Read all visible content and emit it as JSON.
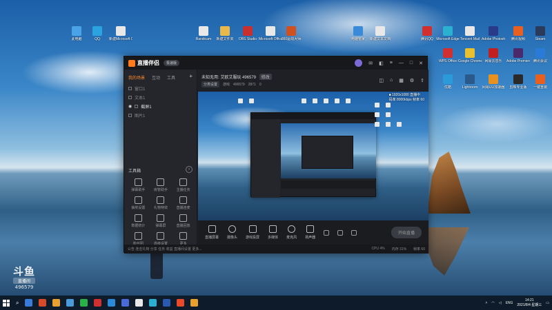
{
  "desktop_icons": [
    {
      "label": "此电脑",
      "color": "#4aa3e6"
    },
    {
      "label": "QQ",
      "color": "#2aa3e0"
    },
    {
      "label": "新建Microsoft Office...",
      "color": "#e8e8e8"
    },
    {
      "label": "Bandicam",
      "color": "#e8e8e8"
    },
    {
      "label": "新建文件夹",
      "color": "#e8b84a"
    },
    {
      "label": "OBS Studio",
      "color": "#c83030"
    },
    {
      "label": "Microsoft Office",
      "color": "#e8e8e8"
    },
    {
      "label": "360驱动大师",
      "color": "#d05020"
    },
    {
      "label": "电脑管家",
      "color": "#3a8ad8"
    },
    {
      "label": "新建文本文档",
      "color": "#e8e8e8"
    },
    {
      "label": "腾讯QQ",
      "color": "#d03030"
    },
    {
      "label": "Microsoft Edge",
      "color": "#2ab0d0"
    },
    {
      "label": "Tencent Mail",
      "color": "#e8e8e8"
    },
    {
      "label": "Adobe Photoshop",
      "color": "#2a3a8a"
    },
    {
      "label": "腾讯视频",
      "color": "#e86020"
    },
    {
      "label": "Steam",
      "color": "#2a3a5a"
    },
    {
      "label": "WPS Office",
      "color": "#d03030"
    },
    {
      "label": "Google Chrome",
      "color": "#e8c030"
    },
    {
      "label": "网易云音乐",
      "color": "#c02020"
    },
    {
      "label": "Adobe Premiere",
      "color": "#4a2a6a"
    },
    {
      "label": "腾讯会议",
      "color": "#2a7ad8"
    },
    {
      "label": "优酷",
      "color": "#2a9ad8"
    },
    {
      "label": "Lightroom",
      "color": "#2a5a8a"
    },
    {
      "label": "网易UU加速器",
      "color": "#e89020"
    },
    {
      "label": "剪映专业版",
      "color": "#2a2a2a"
    },
    {
      "label": "一键重装",
      "color": "#e86020"
    }
  ],
  "app": {
    "title": "直播伴侣",
    "version": "极速版",
    "tabs": [
      "我的场景",
      "互动",
      "工具"
    ],
    "scenes": [
      "窗口1",
      "文本1",
      "截屏1",
      "图片1"
    ],
    "tools_title": "工具箱",
    "tools": [
      "弹幕助手",
      "房管助手",
      "主播任务",
      "抽奖设置",
      "礼物特效",
      "直播连麦",
      "数据统计",
      "弹幕屏",
      "直播回放",
      "粉丝团",
      "高级设置",
      "更多"
    ],
    "room": {
      "name": "未知无用: 艾欧艾服玩 496579",
      "edit": "修改",
      "category_label": "分类设置",
      "category": "游戏",
      "room_id": "496579",
      "online": "2871",
      "fans": "0"
    },
    "preview_overlay": [
      "■ 1920x1080 直播中",
      "码率 8000kbps  帧率 60"
    ],
    "controls": [
      "直播屏幕",
      "摄像头",
      "游戏投屏",
      "多媒体",
      "麦克风",
      "扬声器"
    ],
    "start_button": "开始直播",
    "status_left": "公告 连击礼物 分享 任务 收益 直播间设置 更多...",
    "status_right": [
      "CPU 4%",
      "内存 31%",
      "帧率 60"
    ]
  },
  "watermark": {
    "brand": "斗鱼",
    "sub": "直播间",
    "room": "496579"
  },
  "taskbar": {
    "apps": [
      "#3a7ad8",
      "#d84a2a",
      "#e8a030",
      "#4a9ad8",
      "#2ab04a",
      "#d03030",
      "#2a8ad8",
      "#4a6ad8",
      "#e8e8e8",
      "#2ab0d0",
      "#2a5ab0",
      "#e84a2a",
      "#e8a030"
    ],
    "lang": "ENG",
    "time": "14:21",
    "date": "2021/8/4 星期三"
  }
}
